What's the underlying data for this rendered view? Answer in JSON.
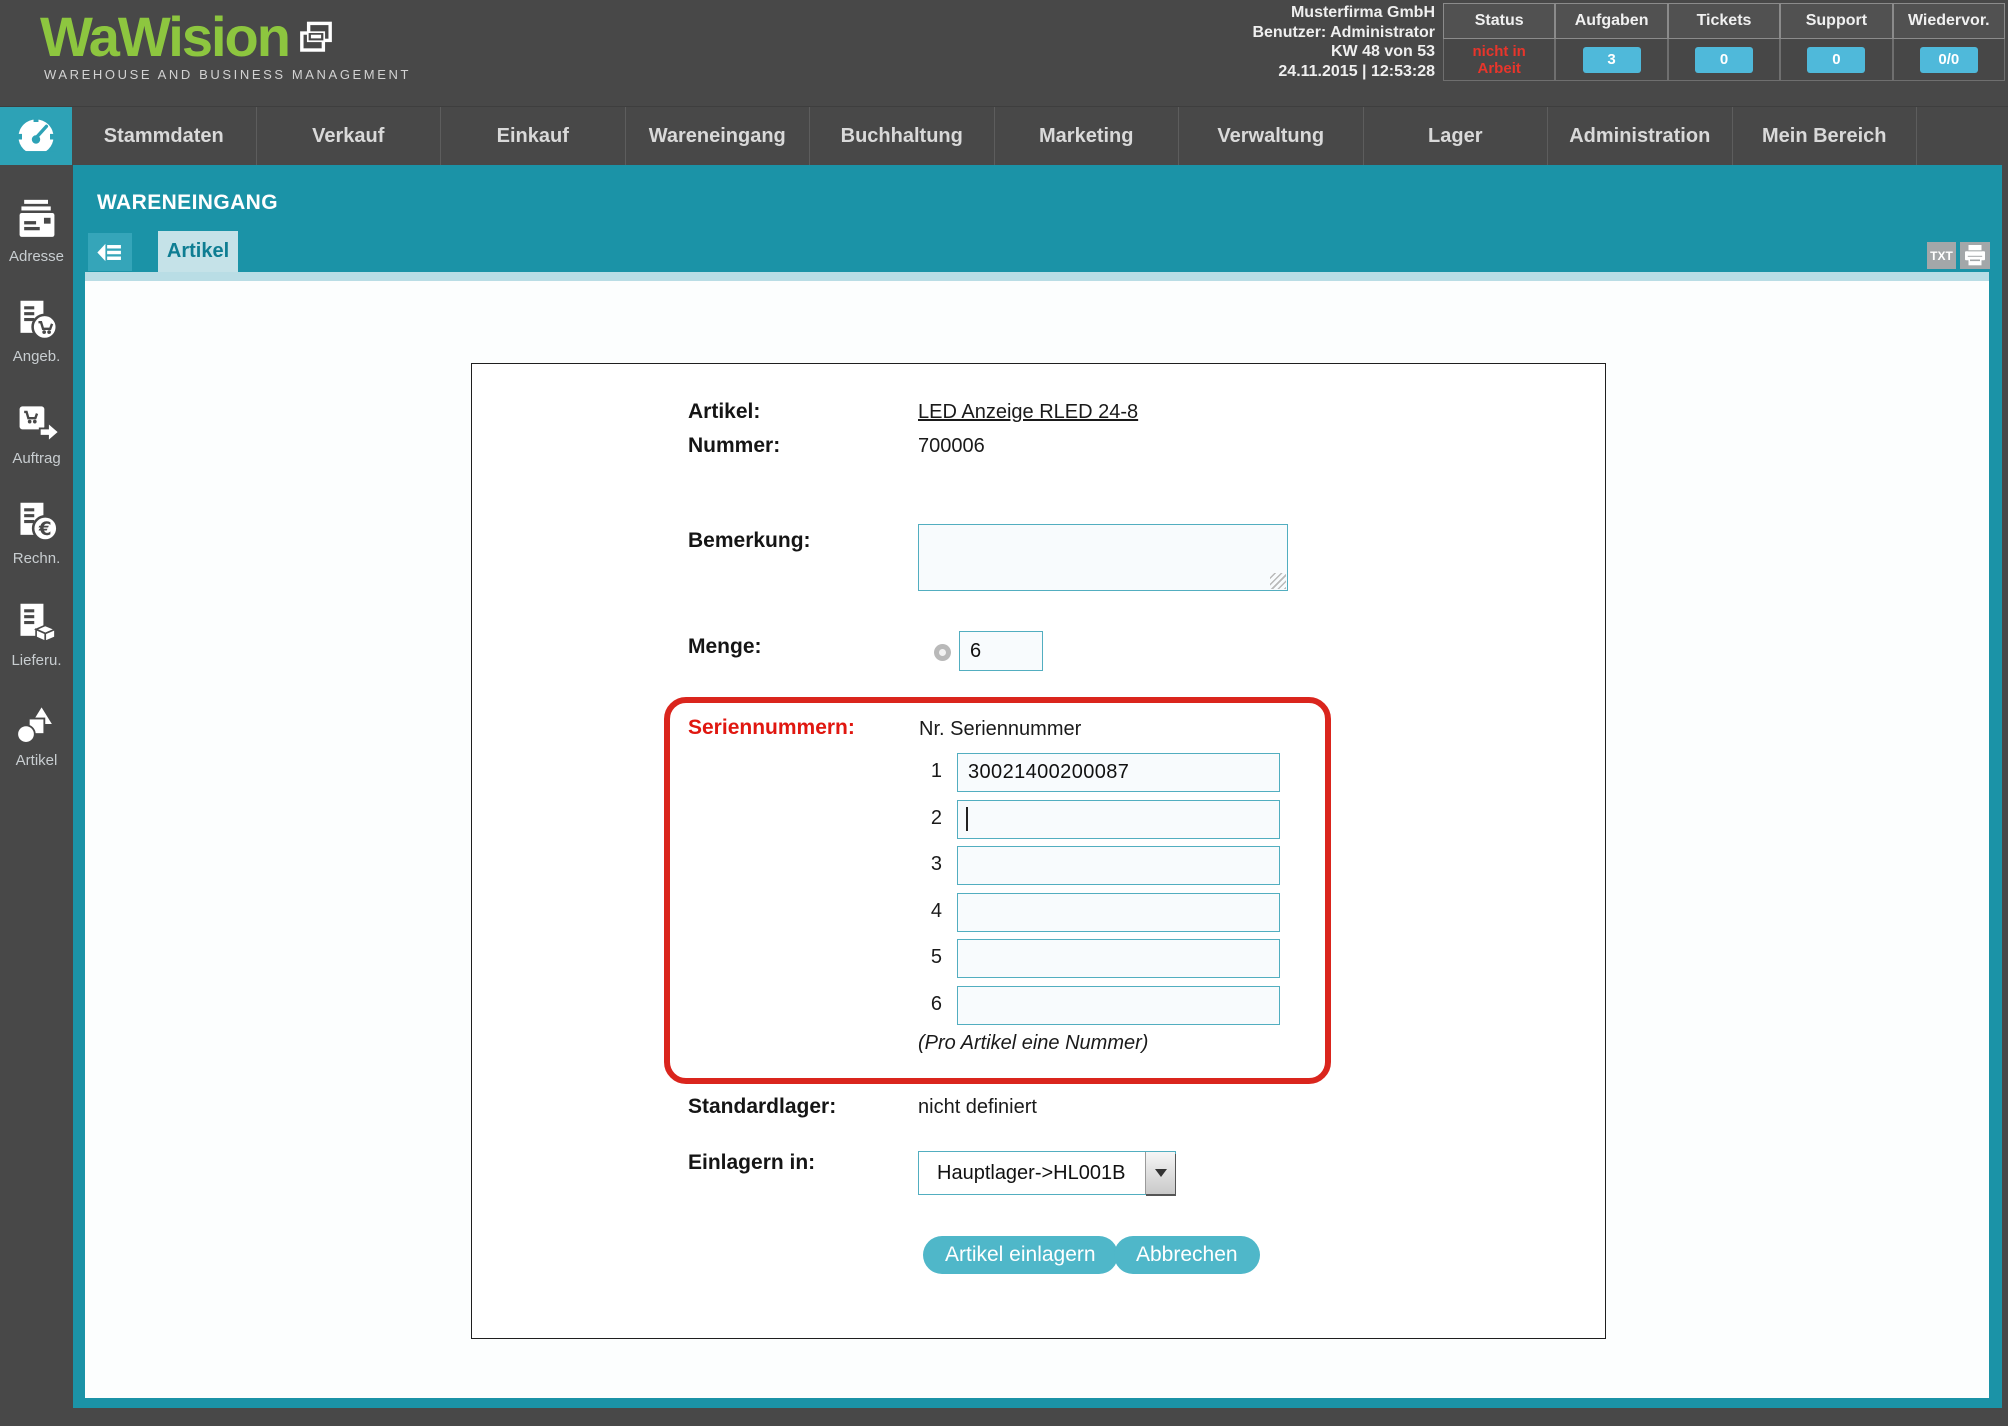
{
  "header": {
    "logo": {
      "name": "WaWision",
      "tagline": "WAREHOUSE AND BUSINESS MANAGEMENT"
    },
    "company": "Musterfirma GmbH",
    "user_line": "Benutzer: Administrator",
    "week_line": "KW 48 von 53",
    "datetime_line": "24.11.2015 | 12:53:28",
    "status_columns": [
      {
        "label": "Status",
        "value": "nicht in Arbeit"
      },
      {
        "label": "Aufgaben",
        "value": "3"
      },
      {
        "label": "Tickets",
        "value": "0"
      },
      {
        "label": "Support",
        "value": "0"
      },
      {
        "label": "Wiedervor.",
        "value": "0/0"
      }
    ]
  },
  "nav": {
    "items": [
      "Stammdaten",
      "Verkauf",
      "Einkauf",
      "Wareneingang",
      "Buchhaltung",
      "Marketing",
      "Verwaltung",
      "Lager",
      "Administration",
      "Mein Bereich"
    ]
  },
  "sidebar": {
    "items": [
      {
        "label": "Adresse",
        "icon": "address-icon"
      },
      {
        "label": "Angeb.",
        "icon": "offer-icon"
      },
      {
        "label": "Auftrag",
        "icon": "order-icon"
      },
      {
        "label": "Rechn.",
        "icon": "invoice-icon"
      },
      {
        "label": "Lieferu.",
        "icon": "delivery-icon"
      },
      {
        "label": "Artikel",
        "icon": "article-icon"
      }
    ]
  },
  "page": {
    "title": "WARENEINGANG",
    "tab": "Artikel",
    "toolbar": {
      "txt_label": "TXT"
    }
  },
  "form": {
    "artikel_label": "Artikel:",
    "artikel_value": "LED Anzeige RLED 24-8",
    "nummer_label": "Nummer:",
    "nummer_value": "700006",
    "bemerkung_label": "Bemerkung:",
    "bemerkung_value": "",
    "menge_label": "Menge:",
    "menge_value": "6",
    "serien_label": "Seriennummern:",
    "serien_header": "Nr. Seriennummer",
    "serien_rows": [
      {
        "nr": "1",
        "value": "30021400200087"
      },
      {
        "nr": "2",
        "value": ""
      },
      {
        "nr": "3",
        "value": ""
      },
      {
        "nr": "4",
        "value": ""
      },
      {
        "nr": "5",
        "value": ""
      },
      {
        "nr": "6",
        "value": ""
      }
    ],
    "serien_note": "(Pro Artikel eine Nummer)",
    "standardlager_label": "Standardlager:",
    "standardlager_value": "nicht definiert",
    "einlagern_label": "Einlagern in:",
    "einlagern_value": "Hauptlager->HL001B",
    "submit_label": "Artikel einlagern",
    "cancel_label": "Abbrechen"
  },
  "colors": {
    "teal": "#1b93a7",
    "teal_light": "#2da2b6",
    "badge_cyan": "#4fb9da",
    "alert_red": "#da251d",
    "status_red": "#e8352b",
    "logo_green": "#8dc63f",
    "button_teal": "#4fb7c9",
    "dark_gray": "#484848"
  }
}
